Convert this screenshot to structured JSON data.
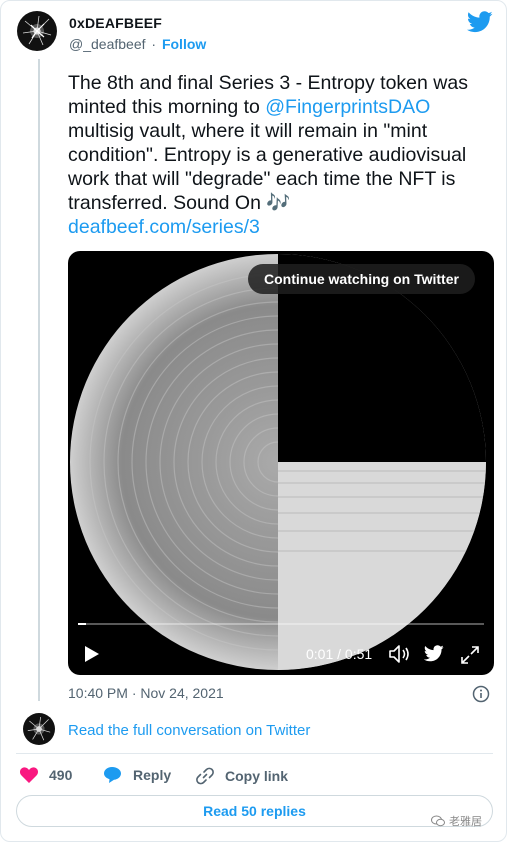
{
  "author": {
    "name": "0xDEAFBEEF",
    "handle": "@_deafbeef",
    "separator": "·",
    "follow_label": "Follow"
  },
  "tweet": {
    "text_1": "The 8th and final Series 3 - Entropy token was minted this morning to ",
    "mention": "@FingerprintsDAO",
    "text_2": " multisig vault, where it will remain in \"mint condition\". Entropy is a generative audiovisual work that will \"degrade\" each time the NFT is transferred. Sound On ",
    "emoji": "🎶",
    "link": "deafbeef.com/series/3"
  },
  "media": {
    "continue_label": "Continue watching on Twitter",
    "time": "0:01 / 0:51",
    "progress": 0.02
  },
  "timestamp": "10:40 PM · Nov 24, 2021",
  "conversation_label": "Read the full conversation on Twitter",
  "actions": {
    "likes": "490",
    "reply_label": "Reply",
    "copy_label": "Copy link"
  },
  "replies_label": "Read 50 replies",
  "watermark": "老雅居",
  "colors": {
    "accent": "#1d9bf0",
    "heart": "#f91880",
    "text": "#0f1419",
    "muted": "#536471"
  }
}
